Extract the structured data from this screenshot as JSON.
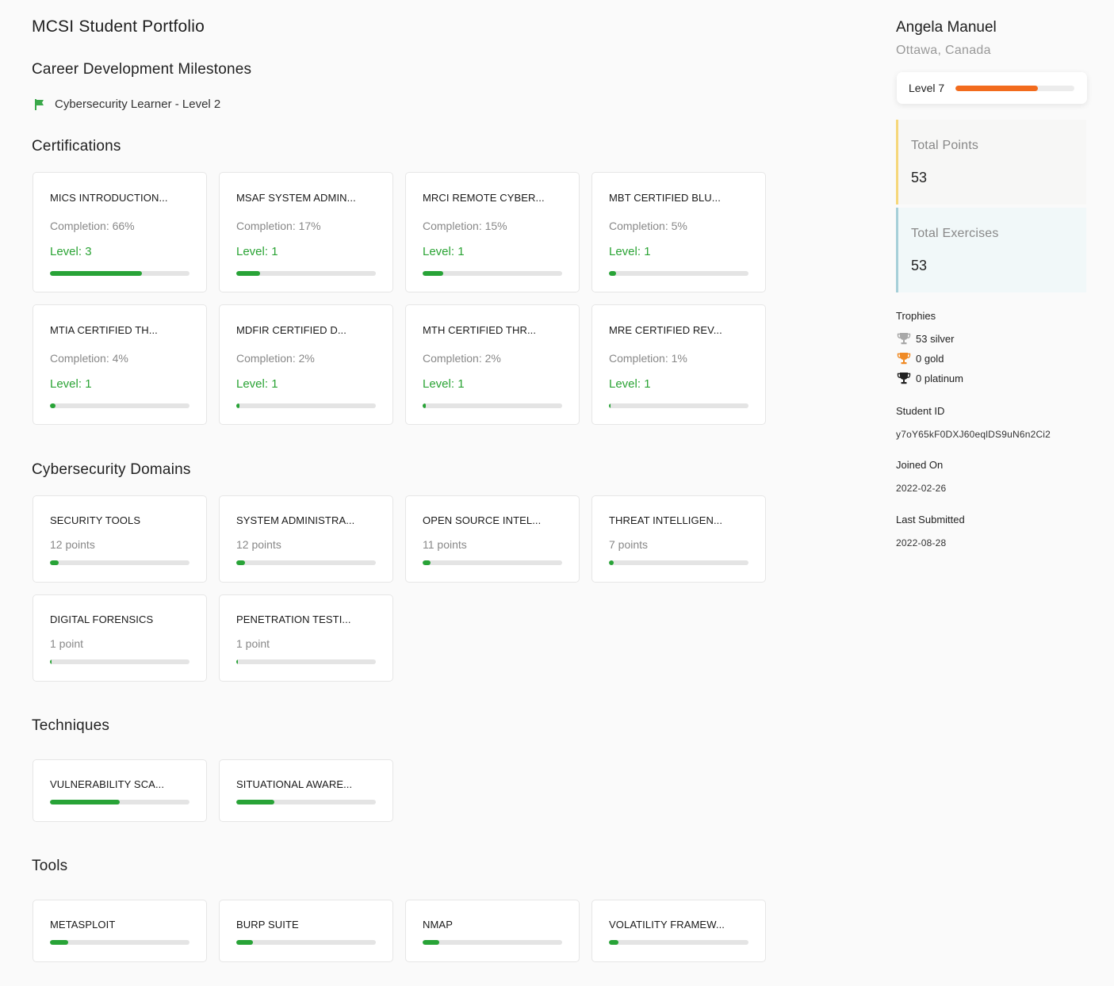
{
  "page_title": "MCSI Student Portfolio",
  "sections": {
    "milestones": "Career Development Milestones",
    "certifications": "Certifications",
    "domains": "Cybersecurity Domains",
    "techniques": "Techniques",
    "tools": "Tools"
  },
  "milestone": {
    "label": "Cybersecurity Learner - Level 2",
    "icon": "flag-icon",
    "color": "#3aa84a"
  },
  "certifications": [
    {
      "title": "MICS INTRODUCTION...",
      "completion": "Completion: 66%",
      "level": "Level: 3",
      "progress": 0.66
    },
    {
      "title": "MSAF SYSTEM ADMIN...",
      "completion": "Completion: 17%",
      "level": "Level: 1",
      "progress": 0.17
    },
    {
      "title": "MRCI REMOTE CYBER...",
      "completion": "Completion: 15%",
      "level": "Level: 1",
      "progress": 0.15
    },
    {
      "title": "MBT CERTIFIED BLU...",
      "completion": "Completion: 5%",
      "level": "Level: 1",
      "progress": 0.05
    },
    {
      "title": "MTIA CERTIFIED TH...",
      "completion": "Completion: 4%",
      "level": "Level: 1",
      "progress": 0.04
    },
    {
      "title": "MDFIR CERTIFIED D...",
      "completion": "Completion: 2%",
      "level": "Level: 1",
      "progress": 0.02
    },
    {
      "title": "MTH CERTIFIED THR...",
      "completion": "Completion: 2%",
      "level": "Level: 1",
      "progress": 0.02
    },
    {
      "title": "MRE CERTIFIED REV...",
      "completion": "Completion: 1%",
      "level": "Level: 1",
      "progress": 0.01
    }
  ],
  "domains": [
    {
      "title": "SECURITY TOOLS",
      "points": "12 points",
      "progress": 0.06
    },
    {
      "title": "SYSTEM ADMINISTRA...",
      "points": "12 points",
      "progress": 0.06
    },
    {
      "title": "OPEN SOURCE INTEL...",
      "points": "11 points",
      "progress": 0.055
    },
    {
      "title": "THREAT INTELLIGEN...",
      "points": "7 points",
      "progress": 0.035
    },
    {
      "title": "DIGITAL FORENSICS",
      "points": "1 point",
      "progress": 0.005
    },
    {
      "title": "PENETRATION TESTI...",
      "points": "1 point",
      "progress": 0.005
    }
  ],
  "techniques": [
    {
      "title": "VULNERABILITY SCA...",
      "progress": 0.5
    },
    {
      "title": "SITUATIONAL AWARE...",
      "progress": 0.27
    }
  ],
  "tools": [
    {
      "title": "METASPLOIT",
      "progress": 0.13
    },
    {
      "title": "BURP SUITE",
      "progress": 0.12
    },
    {
      "title": "NMAP",
      "progress": 0.12
    },
    {
      "title": "VOLATILITY FRAMEW...",
      "progress": 0.07
    }
  ],
  "profile": {
    "name": "Angela Manuel",
    "location": "Ottawa, Canada",
    "level_label": "Level 7",
    "level_progress": 0.69,
    "total_points_label": "Total Points",
    "total_points": "53",
    "total_exercises_label": "Total Exercises",
    "total_exercises": "53",
    "trophies_label": "Trophies",
    "trophies": [
      {
        "label": "53 silver",
        "icon": "trophy-silver-icon",
        "color": "#a8a8a8"
      },
      {
        "label": "0 gold",
        "icon": "trophy-gold-icon",
        "color": "#f08a24"
      },
      {
        "label": "0 platinum",
        "icon": "trophy-platinum-icon",
        "color": "#222222"
      }
    ],
    "student_id_label": "Student ID",
    "student_id": "y7oY65kF0DXJ60eqlDS9uN6n2Ci2",
    "joined_label": "Joined On",
    "joined": "2022-02-26",
    "last_submitted_label": "Last Submitted",
    "last_submitted": "2022-08-28"
  },
  "colors": {
    "accent_green": "#28a337",
    "level_orange": "#f26b1d"
  }
}
